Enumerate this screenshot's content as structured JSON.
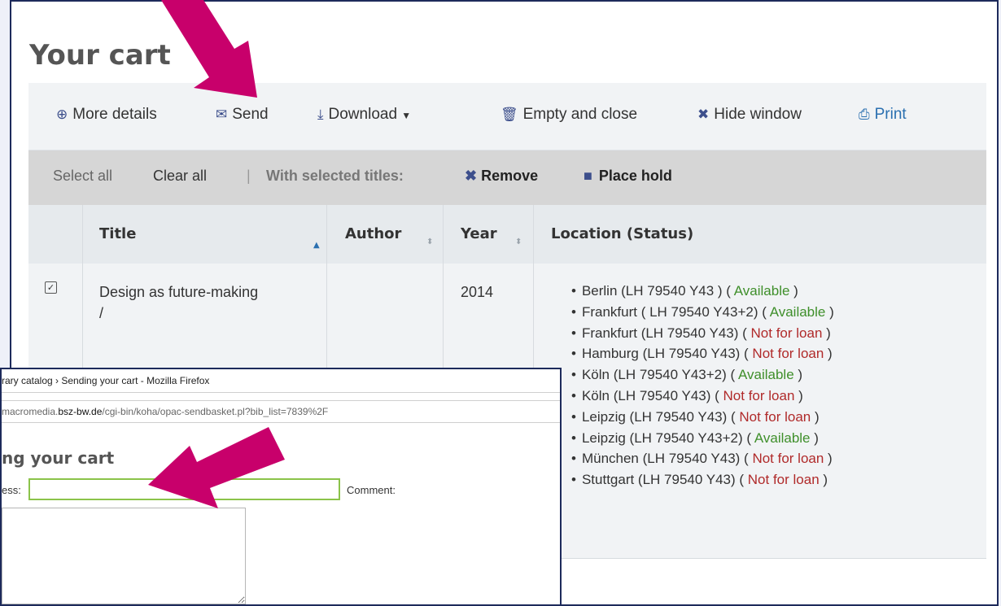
{
  "page": {
    "title": "Your cart"
  },
  "toolbar": {
    "more_details": "More details",
    "send": "Send",
    "download": "Download",
    "empty_close": "Empty and close",
    "hide_window": "Hide window",
    "print": "Print"
  },
  "selection": {
    "select_all": "Select all",
    "clear_all": "Clear all",
    "with_selected": "With selected titles:",
    "remove": "Remove",
    "place_hold": "Place hold"
  },
  "table": {
    "columns": [
      "Title",
      "Author",
      "Year",
      "Location (Status)"
    ],
    "row": {
      "checked": true,
      "title": "Design as future-making",
      "title_suffix": "/",
      "author": "",
      "year": "2014",
      "locations": [
        {
          "place": "Berlin (LH 79540 Y43 )",
          "status": "Available",
          "status_kind": "available"
        },
        {
          "place": "Frankfurt ( LH 79540 Y43+2)",
          "status": "Available",
          "status_kind": "available"
        },
        {
          "place": "Frankfurt (LH 79540 Y43)",
          "status": "Not for loan",
          "status_kind": "notloan"
        },
        {
          "place": "Hamburg (LH 79540 Y43)",
          "status": "Not for loan",
          "status_kind": "notloan"
        },
        {
          "place": "Köln (LH 79540 Y43+2)",
          "status": "Available",
          "status_kind": "available"
        },
        {
          "place": "Köln (LH 79540 Y43)",
          "status": "Not for loan",
          "status_kind": "notloan"
        },
        {
          "place": "Leipzig (LH 79540 Y43)",
          "status": "Not for loan",
          "status_kind": "notloan"
        },
        {
          "place": "Leipzig (LH 79540 Y43+2)",
          "status": "Available",
          "status_kind": "available"
        },
        {
          "place": "München (LH 79540 Y43)",
          "status": "Not for loan",
          "status_kind": "notloan"
        },
        {
          "place": "Stuttgart (LH 79540 Y43)",
          "status": "Not for loan",
          "status_kind": "notloan"
        }
      ]
    }
  },
  "popup": {
    "window_title": "rary catalog › Sending your cart - Mozilla Firefox",
    "url_prefix": "macromedia.",
    "url_domain": "bsz-bw.de",
    "url_path": "/cgi-bin/koha/opac-sendbasket.pl?bib_list=7839%2F",
    "heading": "ng your cart",
    "email_label": "ess:",
    "comment_label": "Comment:"
  },
  "colors": {
    "arrow": "#c8006b",
    "available": "#3f8f2b",
    "not_for_loan": "#b02a2a",
    "link": "#2a6fb0"
  }
}
